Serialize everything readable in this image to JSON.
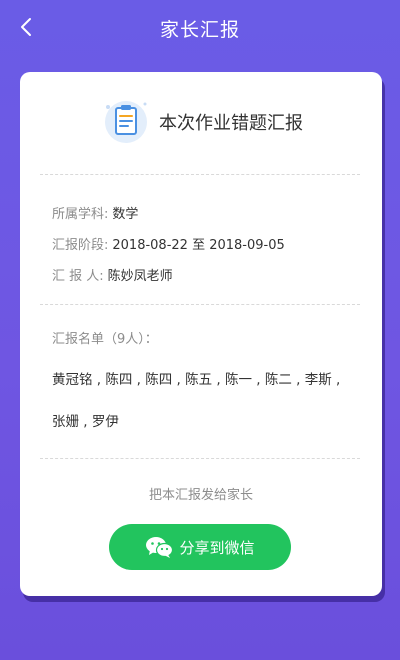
{
  "header": {
    "title": "家长汇报"
  },
  "card": {
    "title": "本次作业错题汇报",
    "info": {
      "subject_label": "所属学科:",
      "subject_value": "数学",
      "period_label": "汇报阶段:",
      "period_value": "2018-08-22 至 2018-09-05",
      "reporter_label": "汇 报 人:",
      "reporter_value": "陈妙凤老师"
    },
    "list": {
      "label": "汇报名单（9人）：",
      "names": "黄冠铭 , 陈四 , 陈四 , 陈五 , 陈一 , 陈二 , 李斯 , 张姗 , 罗伊"
    },
    "send_text": "把本汇报发给家长",
    "share_label": "分享到微信"
  },
  "icons": {
    "back": "chevron-left-icon",
    "report": "clipboard-icon",
    "share": "wechat-icon"
  },
  "colors": {
    "background": "#6a56e2",
    "share_button": "#22c45e",
    "icon_blue": "#4a90e2"
  }
}
